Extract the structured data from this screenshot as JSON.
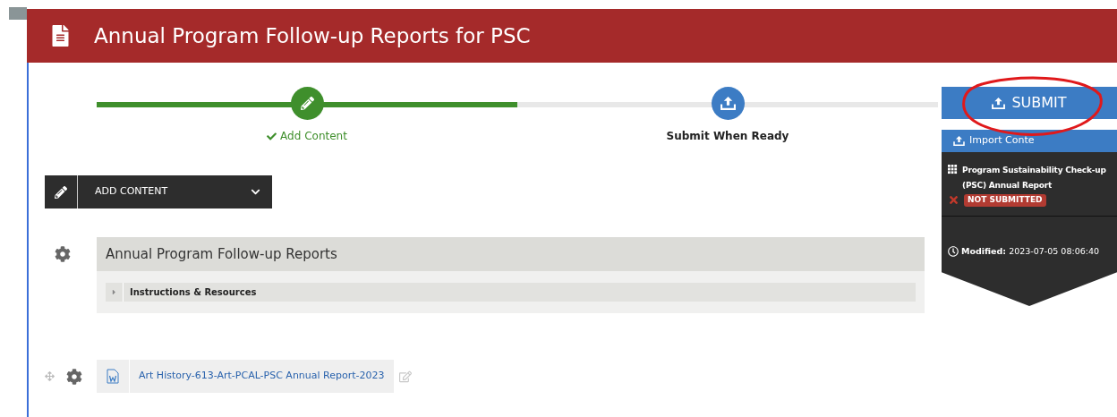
{
  "header": {
    "title": "Annual Program Follow-up Reports for PSC"
  },
  "progress": {
    "level": 0.5,
    "steps": [
      {
        "label": "Add Content",
        "done": true
      },
      {
        "label": "Submit When Ready",
        "done": false
      }
    ]
  },
  "add_menu": {
    "label": "ADD CONTENT",
    "expanded": false
  },
  "section": {
    "title": "Annual Program Follow-up Reports",
    "accordion": {
      "label": "Instructions & Resources",
      "expanded": false
    }
  },
  "document": {
    "link": "Art History-613-Art-PCAL-PSC Annual Report-2023"
  },
  "side_panel": {
    "submit": "SUBMIT",
    "import": "Import Conte",
    "form_title": "Program Sustainability Check-up (PSC) Annual Report",
    "status": {
      "label": "NOT SUBMITTED",
      "submitted": false
    },
    "modified_label": "Modified:",
    "modified_value": "2023-07-05 08:06:40"
  }
}
